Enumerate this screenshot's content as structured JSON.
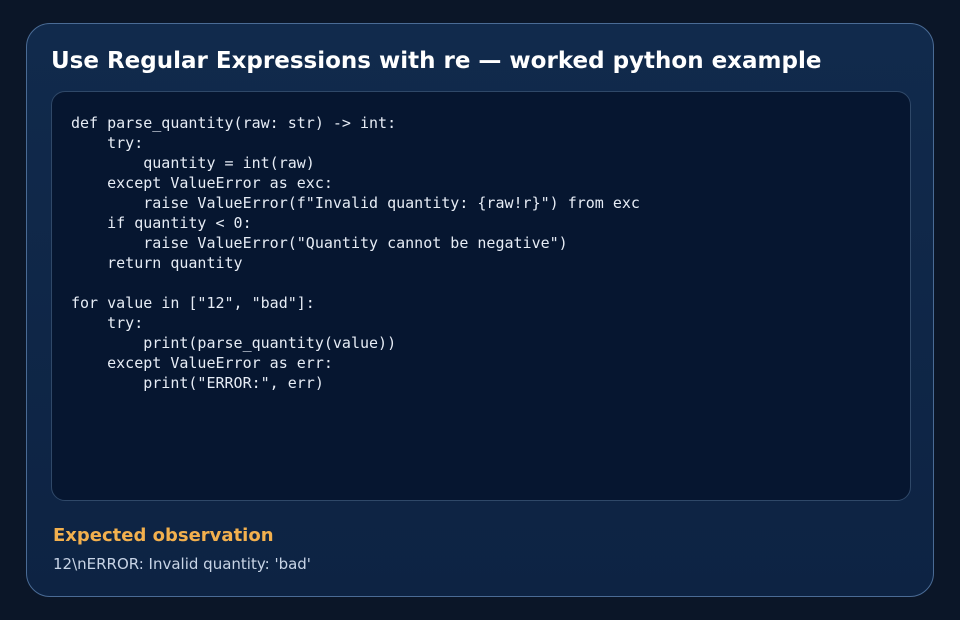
{
  "card": {
    "title": "Use Regular Expressions with re — worked python example"
  },
  "code": {
    "language": "python",
    "source": "def parse_quantity(raw: str) -> int:\n    try:\n        quantity = int(raw)\n    except ValueError as exc:\n        raise ValueError(f\"Invalid quantity: {raw!r}\") from exc\n    if quantity < 0:\n        raise ValueError(\"Quantity cannot be negative\")\n    return quantity\n\nfor value in [\"12\", \"bad\"]:\n    try:\n        print(parse_quantity(value))\n    except ValueError as err:\n        print(\"ERROR:\", err)"
  },
  "observation": {
    "label": "Expected observation",
    "text": "12\\nERROR: Invalid quantity: 'bad'"
  },
  "colors": {
    "background": "#0b1628",
    "card_border": "#4a6b95",
    "code_background": "#061630",
    "accent_label": "#f2b04e"
  }
}
